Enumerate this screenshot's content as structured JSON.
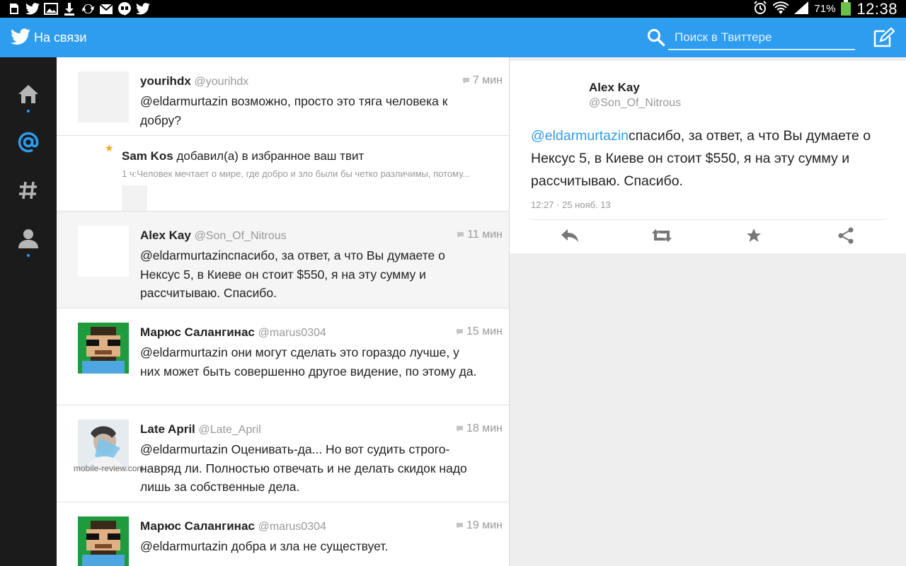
{
  "status_bar": {
    "battery": "71%",
    "time": "12:38"
  },
  "action_bar": {
    "title": "На связи",
    "search_placeholder": "Поиск в Твиттере"
  },
  "nav": {
    "items": [
      "home",
      "mentions",
      "discover",
      "profile"
    ]
  },
  "timeline": {
    "tweets": [
      {
        "name": "yourihdx",
        "handle": "@yourihdx",
        "time": "7 мин",
        "text": "@eldarmurtazin возможно, просто это тяга человека к добру?"
      },
      {
        "name": "Alex Kay",
        "handle": "@Son_Of_Nitrous",
        "time": "11 мин",
        "text": "@eldarmurtazinспасибо, за ответ, а что Вы думаете о Нексус 5, в Киеве он стоит $550, я на эту  сумму и рассчитываю. Спасибо."
      },
      {
        "name": "Марюс Салангинас",
        "handle": "@marus0304",
        "time": "15 мин",
        "text": "@eldarmurtazin они могут сделать это гораздо лучше, у них может быть совершенно другое видение, по этому да."
      },
      {
        "name": "Late April",
        "handle": "@Late_April",
        "time": "18 мин",
        "text": "@eldarmurtazin Оценивать-да... Но вот судить строго-навряд ли. Полностью отвечать и не делать скидок надо лишь за собственные дела."
      },
      {
        "name": "Марюс Салангинас",
        "handle": "@marus0304",
        "time": "19 мин",
        "text": "@eldarmurtazin добра и зла не существует."
      }
    ],
    "favorite_notice": {
      "user": "Sam Kos",
      "action": "добавил(а) в избранное ваш твит",
      "preview": "1 ч:Человек мечтает о мире, где добро и зло были бы четко различимы, потому..."
    }
  },
  "watermark": "mobile-review.com",
  "detail": {
    "name": "Alex Kay",
    "handle": "@Son_Of_Nitrous",
    "mention": "@eldarmurtazin",
    "text": "спасибо, за ответ, а что Вы думаете о Нексус 5, в Киеве он стоит $550, я на эту  сумму и рассчитываю. Спасибо.",
    "timestamp": "12:27 · 25 нояб. 13",
    "actions": [
      "reply",
      "retweet",
      "favorite",
      "share"
    ]
  },
  "colors": {
    "accent": "#2e9df0",
    "nav_bg": "#1b1b1b",
    "favorite_star": "#f4a41d"
  }
}
